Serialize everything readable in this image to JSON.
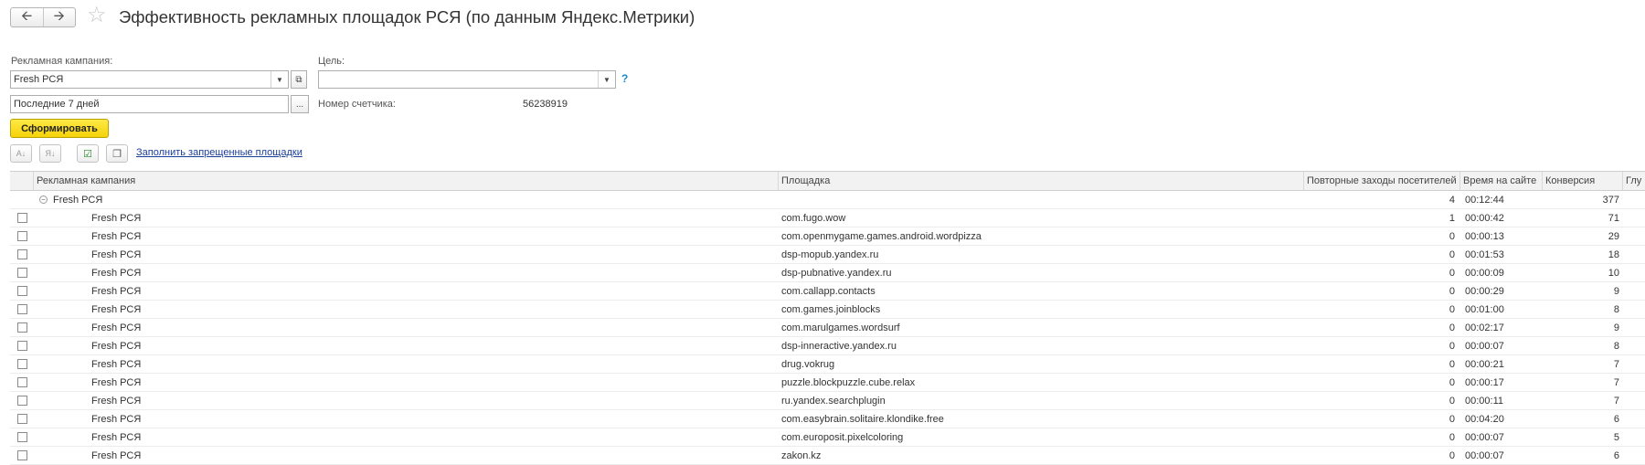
{
  "header": {
    "back_icon": "arrow-left-icon",
    "forward_icon": "arrow-right-icon",
    "favorite_icon": "star-icon",
    "title": "Эффективность рекламных площадок РСЯ (по данным Яндекс.Метрики)"
  },
  "form": {
    "campaign_label": "Рекламная кампания:",
    "campaign_value": "Fresh РСЯ",
    "goal_label": "Цель:",
    "goal_value": "",
    "help_label": "?",
    "period_value": "Последние 7 дней",
    "period_button": "...",
    "counter_label": "Номер счетчика:",
    "counter_value": "56238919",
    "generate_label": "Сформировать"
  },
  "toolbar": {
    "fill_link": "Заполнить запрещенные площадки"
  },
  "table": {
    "columns": [
      "Рекламная кампания",
      "Площадка",
      "Повторные заходы посетителей",
      "Время на сайте",
      "Конверсия",
      "Глу"
    ],
    "group": {
      "name": "Fresh РСЯ",
      "repeat": "4",
      "time": "00:12:44",
      "conv": "377"
    },
    "rows": [
      {
        "campaign": "Fresh РСЯ",
        "site": "com.fugo.wow",
        "repeat": "1",
        "time": "00:00:42",
        "conv": "71"
      },
      {
        "campaign": "Fresh РСЯ",
        "site": "com.openmygame.games.android.wordpizza",
        "repeat": "0",
        "time": "00:00:13",
        "conv": "29"
      },
      {
        "campaign": "Fresh РСЯ",
        "site": "dsp-mopub.yandex.ru",
        "repeat": "0",
        "time": "00:01:53",
        "conv": "18"
      },
      {
        "campaign": "Fresh РСЯ",
        "site": "dsp-pubnative.yandex.ru",
        "repeat": "0",
        "time": "00:00:09",
        "conv": "10"
      },
      {
        "campaign": "Fresh РСЯ",
        "site": "com.callapp.contacts",
        "repeat": "0",
        "time": "00:00:29",
        "conv": "9"
      },
      {
        "campaign": "Fresh РСЯ",
        "site": "com.games.joinblocks",
        "repeat": "0",
        "time": "00:01:00",
        "conv": "8"
      },
      {
        "campaign": "Fresh РСЯ",
        "site": "com.marulgames.wordsurf",
        "repeat": "0",
        "time": "00:02:17",
        "conv": "9"
      },
      {
        "campaign": "Fresh РСЯ",
        "site": "dsp-inneractive.yandex.ru",
        "repeat": "0",
        "time": "00:00:07",
        "conv": "8"
      },
      {
        "campaign": "Fresh РСЯ",
        "site": "drug.vokrug",
        "repeat": "0",
        "time": "00:00:21",
        "conv": "7"
      },
      {
        "campaign": "Fresh РСЯ",
        "site": "puzzle.blockpuzzle.cube.relax",
        "repeat": "0",
        "time": "00:00:17",
        "conv": "7"
      },
      {
        "campaign": "Fresh РСЯ",
        "site": "ru.yandex.searchplugin",
        "repeat": "0",
        "time": "00:00:11",
        "conv": "7"
      },
      {
        "campaign": "Fresh РСЯ",
        "site": "com.easybrain.solitaire.klondike.free",
        "repeat": "0",
        "time": "00:04:20",
        "conv": "6"
      },
      {
        "campaign": "Fresh РСЯ",
        "site": "com.europosit.pixelcoloring",
        "repeat": "0",
        "time": "00:00:07",
        "conv": "5"
      },
      {
        "campaign": "Fresh РСЯ",
        "site": "zakon.kz",
        "repeat": "0",
        "time": "00:00:07",
        "conv": "6"
      }
    ]
  }
}
